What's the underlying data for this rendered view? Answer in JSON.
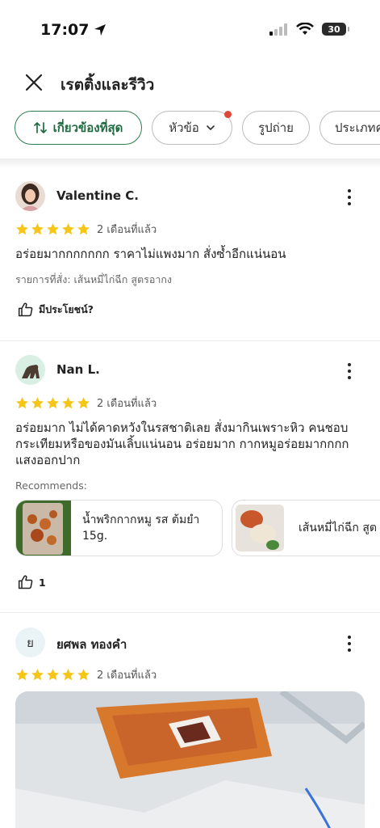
{
  "status_bar": {
    "time": "17:07",
    "battery": "30"
  },
  "header": {
    "title": "เรตติ้งและรีวิว"
  },
  "filters": [
    {
      "label": "เกี่ยวข้องที่สุด",
      "active": true,
      "icon": "sort-icon"
    },
    {
      "label": "หัวข้อ",
      "icon": "chevron-down-icon",
      "has_dot": true
    },
    {
      "label": "รูปถ่าย"
    },
    {
      "label": "ประเภทค"
    }
  ],
  "reviews": [
    {
      "author": "Valentine C.",
      "rating": 5,
      "date": "2 เดือนที่แล้ว",
      "text": "อร่อยมากกกกกกก ราคาไม่แพงมาก สั่งซ้ำอีกแน่นอน",
      "ordered": "รายการที่สั่ง: เส้นหมี่ไก่ฉีก สูตรอากง",
      "helpful": "มีประโยชน์?"
    },
    {
      "author": "Nan L.",
      "rating": 5,
      "date": "2 เดือนที่แล้ว",
      "text": "อร่อยมาก ไม่ได้คาดหวังในรสชาติเลย สั่งมากินเพราะหิว คนชอบกระเทียมหรือของมันเลิ้บแน่นอน อร่อยมาก กากหมูอร่อยมากกกก แสงออกปาก",
      "recommends_label": "Recommends:",
      "recommends": [
        "น้ำพริกกากหมู รส ต้มยำ 15g.",
        "เส้นหมี่ไก่ฉีก สูต"
      ],
      "helpful_count": "1"
    },
    {
      "author": "ยศพล ทองคำ",
      "avatar_letter": "ย",
      "rating": 5,
      "date": "2 เดือนที่แล้ว"
    }
  ],
  "colors": {
    "accent": "#2e7d4f",
    "star": "#f5c518",
    "dot": "#e0463a"
  }
}
